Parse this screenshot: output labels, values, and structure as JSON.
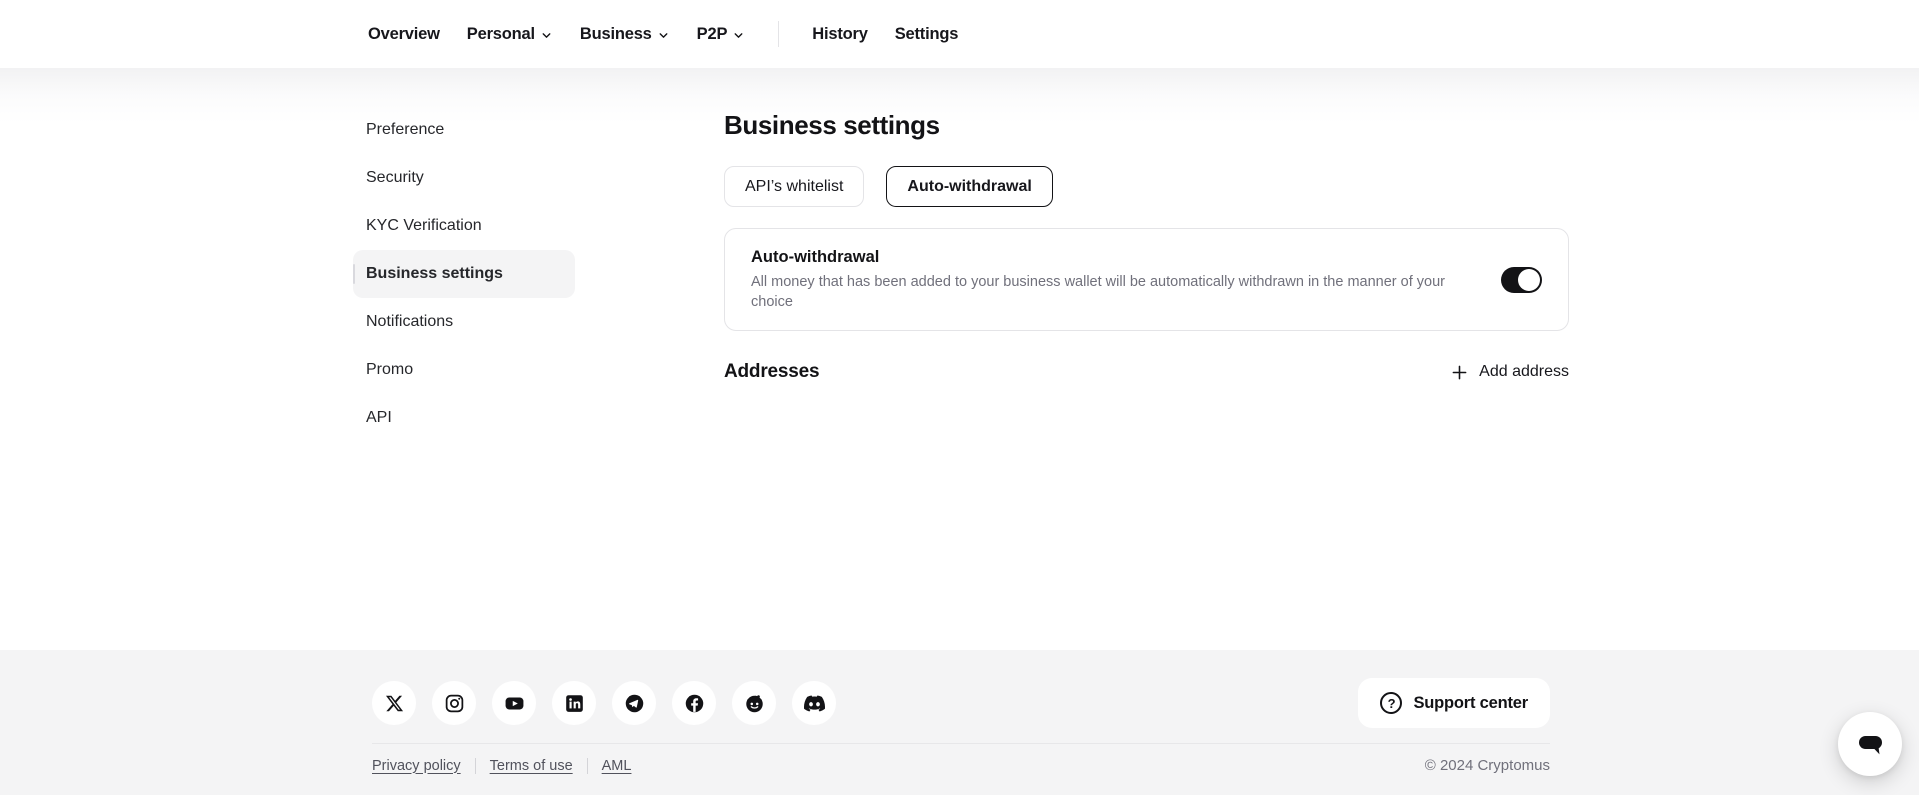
{
  "header": {
    "nav": [
      {
        "label": "Overview",
        "dropdown": false
      },
      {
        "label": "Personal",
        "dropdown": true
      },
      {
        "label": "Business",
        "dropdown": true
      },
      {
        "label": "P2P",
        "dropdown": true
      },
      {
        "label": "History",
        "dropdown": false
      },
      {
        "label": "Settings",
        "dropdown": false
      }
    ]
  },
  "sidebar": {
    "items": [
      {
        "label": "Preference",
        "active": false
      },
      {
        "label": "Security",
        "active": false
      },
      {
        "label": "KYC Verification",
        "active": false
      },
      {
        "label": "Business settings",
        "active": true
      },
      {
        "label": "Notifications",
        "active": false
      },
      {
        "label": "Promo",
        "active": false
      },
      {
        "label": "API",
        "active": false
      }
    ]
  },
  "main": {
    "title": "Business settings",
    "tabs": [
      {
        "label": "API’s whitelist",
        "active": false
      },
      {
        "label": "Auto-withdrawal",
        "active": true
      }
    ],
    "auto_withdrawal": {
      "title": "Auto-withdrawal",
      "description": "All money that has been added to your business wallet will be automatically withdrawn in the manner of your choice",
      "toggle_state": "on"
    },
    "addresses": {
      "title": "Addresses",
      "add_button_label": "Add address"
    }
  },
  "footer": {
    "social_icons": [
      "x",
      "instagram",
      "youtube",
      "linkedin",
      "telegram",
      "facebook",
      "reddit",
      "discord"
    ],
    "support_button_label": "Support center",
    "links": [
      "Privacy policy",
      "Terms of use",
      "AML"
    ],
    "copyright": "© 2024 Cryptomus"
  },
  "icons": {
    "question_mark": "?"
  },
  "colors": {
    "accent_black": "#131316",
    "border": "#e4e4e7",
    "footer_bg": "#f4f4f5",
    "muted_text": "#70707b",
    "link_text": "#51525c"
  }
}
